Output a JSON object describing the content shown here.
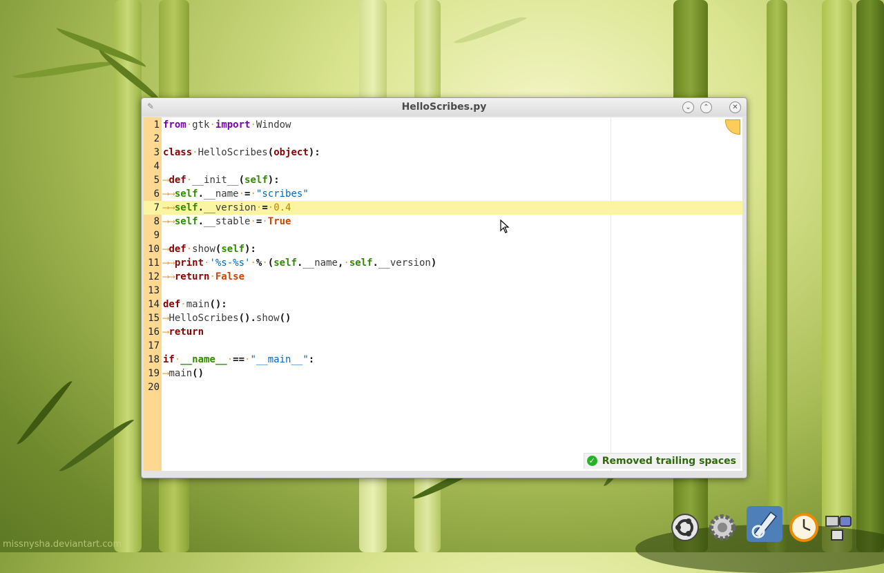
{
  "window": {
    "title": "HelloScribes.py"
  },
  "editor": {
    "current_line": 7,
    "lines": [
      {
        "n": "1",
        "tokens": [
          {
            "t": "from",
            "c": "fi"
          },
          {
            "t": "·",
            "c": "ws"
          },
          {
            "t": "gtk"
          },
          {
            "t": "·",
            "c": "ws"
          },
          {
            "t": "import",
            "c": "fi"
          },
          {
            "t": "·",
            "c": "ws"
          },
          {
            "t": "Window"
          }
        ]
      },
      {
        "n": "2",
        "tokens": []
      },
      {
        "n": "3",
        "tokens": [
          {
            "t": "class",
            "c": "kw"
          },
          {
            "t": "·",
            "c": "ws"
          },
          {
            "t": "HelloScribes"
          },
          {
            "t": "(",
            "c": "op"
          },
          {
            "t": "object",
            "c": "kw"
          },
          {
            "t": "):",
            "c": "op"
          }
        ]
      },
      {
        "n": "4",
        "tokens": []
      },
      {
        "n": "5",
        "tokens": [
          {
            "t": "⟶",
            "c": "ws"
          },
          {
            "t": "def",
            "c": "kw"
          },
          {
            "t": "·",
            "c": "ws"
          },
          {
            "t": "__init__"
          },
          {
            "t": "(",
            "c": "op"
          },
          {
            "t": "self",
            "c": "sf"
          },
          {
            "t": "):",
            "c": "op"
          }
        ]
      },
      {
        "n": "6",
        "tokens": [
          {
            "t": "⟶⟶",
            "c": "ws"
          },
          {
            "t": "self",
            "c": "sf"
          },
          {
            "t": ".",
            "c": "op"
          },
          {
            "t": "__name"
          },
          {
            "t": "·",
            "c": "ws"
          },
          {
            "t": "=",
            "c": "op"
          },
          {
            "t": "·",
            "c": "ws"
          },
          {
            "t": "\"scribes\"",
            "c": "st"
          }
        ]
      },
      {
        "n": "7",
        "tokens": [
          {
            "t": "⟶⟶",
            "c": "ws"
          },
          {
            "t": "self",
            "c": "sf"
          },
          {
            "t": ".",
            "c": "op"
          },
          {
            "t": "__version"
          },
          {
            "t": "·",
            "c": "ws"
          },
          {
            "t": "=",
            "c": "op"
          },
          {
            "t": "·",
            "c": "ws"
          },
          {
            "t": "0.4",
            "c": "nu"
          }
        ]
      },
      {
        "n": "8",
        "tokens": [
          {
            "t": "⟶⟶",
            "c": "ws"
          },
          {
            "t": "self",
            "c": "sf"
          },
          {
            "t": ".",
            "c": "op"
          },
          {
            "t": "__stable"
          },
          {
            "t": "·",
            "c": "ws"
          },
          {
            "t": "=",
            "c": "op"
          },
          {
            "t": "·",
            "c": "ws"
          },
          {
            "t": "True",
            "c": "bo"
          }
        ]
      },
      {
        "n": "9",
        "tokens": []
      },
      {
        "n": "10",
        "tokens": [
          {
            "t": "⟶",
            "c": "ws"
          },
          {
            "t": "def",
            "c": "kw"
          },
          {
            "t": "·",
            "c": "ws"
          },
          {
            "t": "show"
          },
          {
            "t": "(",
            "c": "op"
          },
          {
            "t": "self",
            "c": "sf"
          },
          {
            "t": "):",
            "c": "op"
          }
        ]
      },
      {
        "n": "11",
        "tokens": [
          {
            "t": "⟶⟶",
            "c": "ws"
          },
          {
            "t": "print",
            "c": "kw"
          },
          {
            "t": "·",
            "c": "ws"
          },
          {
            "t": "'%s-%s'",
            "c": "st"
          },
          {
            "t": "·",
            "c": "ws"
          },
          {
            "t": "%",
            "c": "op"
          },
          {
            "t": "·",
            "c": "ws"
          },
          {
            "t": "(",
            "c": "op"
          },
          {
            "t": "self",
            "c": "sf"
          },
          {
            "t": ".",
            "c": "op"
          },
          {
            "t": "__name"
          },
          {
            "t": ",",
            "c": "op"
          },
          {
            "t": "·",
            "c": "ws"
          },
          {
            "t": "self",
            "c": "sf"
          },
          {
            "t": ".",
            "c": "op"
          },
          {
            "t": "__version"
          },
          {
            "t": ")",
            "c": "op"
          }
        ]
      },
      {
        "n": "12",
        "tokens": [
          {
            "t": "⟶⟶",
            "c": "ws"
          },
          {
            "t": "return",
            "c": "kw"
          },
          {
            "t": "·",
            "c": "ws"
          },
          {
            "t": "False",
            "c": "bo"
          }
        ]
      },
      {
        "n": "13",
        "tokens": []
      },
      {
        "n": "14",
        "tokens": [
          {
            "t": "def",
            "c": "kw"
          },
          {
            "t": "·",
            "c": "ws"
          },
          {
            "t": "main"
          },
          {
            "t": "():",
            "c": "op"
          }
        ]
      },
      {
        "n": "15",
        "tokens": [
          {
            "t": "⟶",
            "c": "ws"
          },
          {
            "t": "HelloScribes"
          },
          {
            "t": "().",
            "c": "op"
          },
          {
            "t": "show"
          },
          {
            "t": "()",
            "c": "op"
          }
        ]
      },
      {
        "n": "16",
        "tokens": [
          {
            "t": "⟶",
            "c": "ws"
          },
          {
            "t": "return",
            "c": "kw"
          }
        ]
      },
      {
        "n": "17",
        "tokens": []
      },
      {
        "n": "18",
        "tokens": [
          {
            "t": "if",
            "c": "kw"
          },
          {
            "t": "·",
            "c": "ws"
          },
          {
            "t": "__name__",
            "c": "sf"
          },
          {
            "t": "·",
            "c": "ws"
          },
          {
            "t": "==",
            "c": "op"
          },
          {
            "t": "·",
            "c": "ws"
          },
          {
            "t": "\"__main__\"",
            "c": "st"
          },
          {
            "t": ":",
            "c": "op"
          }
        ]
      },
      {
        "n": "19",
        "tokens": [
          {
            "t": "⟶",
            "c": "ws"
          },
          {
            "t": "main"
          },
          {
            "t": "()",
            "c": "op"
          }
        ]
      },
      {
        "n": "20",
        "tokens": []
      }
    ]
  },
  "status": {
    "message": "Removed trailing spaces"
  },
  "watermark": "missnysha.deviantart.com",
  "dock": {
    "items": [
      {
        "name": "ubuntu-icon"
      },
      {
        "name": "settings-gear-icon"
      },
      {
        "name": "scribes-editor-icon"
      },
      {
        "name": "clock-icon"
      },
      {
        "name": "windows-clipboard-icon"
      }
    ]
  },
  "colors": {
    "gutter": "#fdd890",
    "current_line": "#fbf5a1",
    "status_text": "#2f6a0a"
  }
}
